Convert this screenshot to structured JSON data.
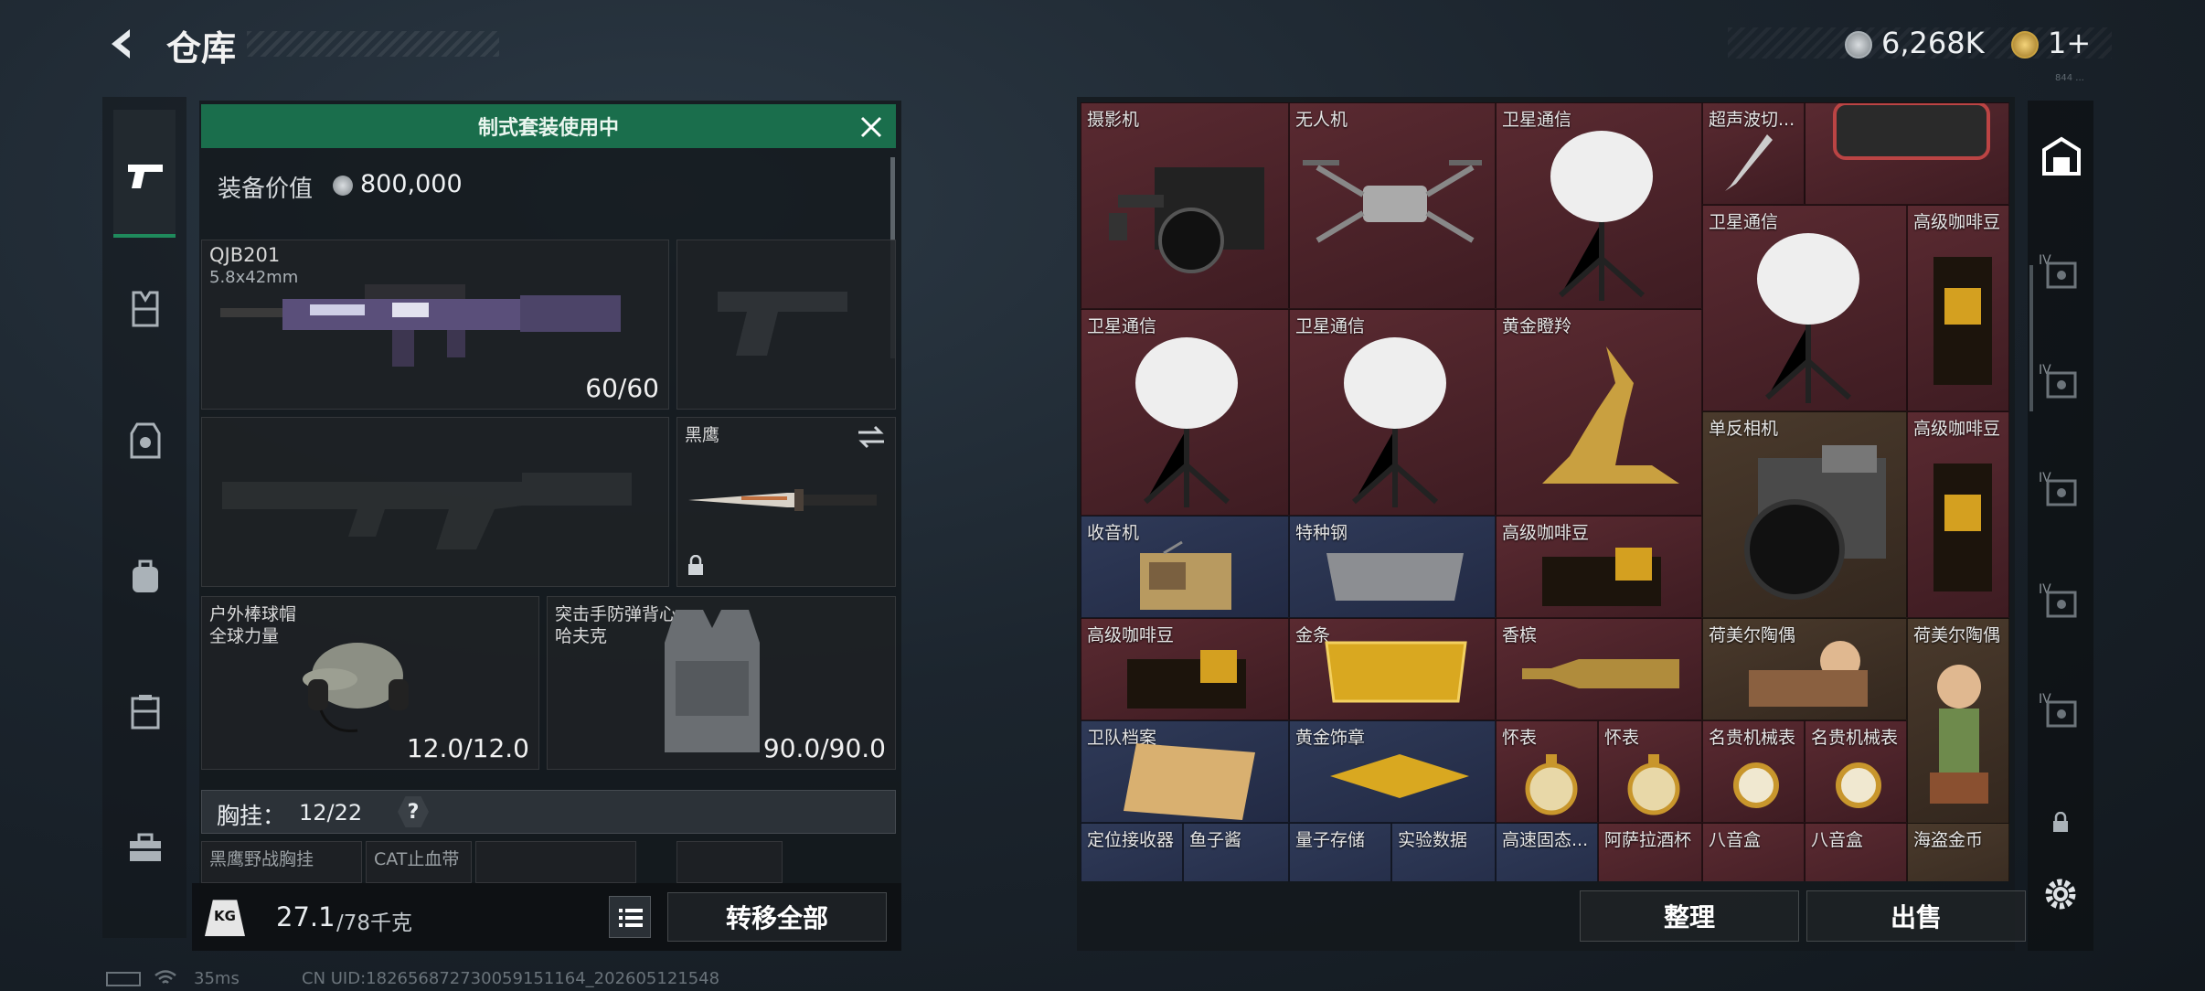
{
  "header": {
    "title": "仓库",
    "currency_silver": "6,268K",
    "currency_gold": "1+",
    "version_tag": "844 ..."
  },
  "loadout": {
    "banner": "制式套装使用中",
    "value_label": "装备价值",
    "value": "800,000",
    "primary": {
      "name": "QJB201",
      "caliber": "5.8x42mm",
      "ammo": "60/60"
    },
    "melee": {
      "name": "黑鹰"
    },
    "helmet": {
      "name_line1": "户外棒球帽",
      "name_line2": "全球力量",
      "durability": "12.0/12.0"
    },
    "armor": {
      "name_line1": "突击手防弹背心",
      "name_line2": "哈夫克",
      "durability": "90.0/90.0"
    },
    "chest_rig": {
      "label": "胸挂：",
      "count": "12/22",
      "help": "?"
    },
    "rig_slots": [
      "黑鹰野战胸挂",
      "CAT止血带"
    ],
    "weight": {
      "current": "27.1",
      "max": "/78千克",
      "icon": "KG"
    },
    "transfer_all": "转移全部"
  },
  "stash": {
    "items": [
      "摄影机",
      "无人机",
      "卫星通信",
      "超声波切...",
      "卫星通信",
      "高级咖啡豆",
      "卫星通信",
      "卫星通信",
      "黄金瞪羚",
      "单反相机",
      "高级咖啡豆",
      "收音机",
      "特种钢",
      "高级咖啡豆",
      "高级咖啡豆",
      "金条",
      "香槟",
      "荷美尔陶偶",
      "荷美尔陶偶",
      "卫队档案",
      "黄金饰章",
      "怀表",
      "怀表",
      "名贵机械表",
      "名贵机械表",
      "定位接收器",
      "鱼子酱",
      "量子存储",
      "实验数据",
      "高速固态...",
      "阿萨拉酒杯",
      "八音盒",
      "八音盒",
      "海盗金币"
    ],
    "tier_labels": [
      "IV",
      "IV",
      "IV",
      "IV",
      "IV"
    ],
    "sort_button": "整理",
    "sell_button": "出售"
  },
  "status_bar": {
    "ping": "35ms",
    "uid": "CN UID:182656872730059151164_202605121548"
  },
  "colors": {
    "accent_green": "#1f8a5c",
    "cell_red": "#4a232a",
    "cell_blue": "#28304c",
    "cell_brown": "#3d2f24"
  }
}
